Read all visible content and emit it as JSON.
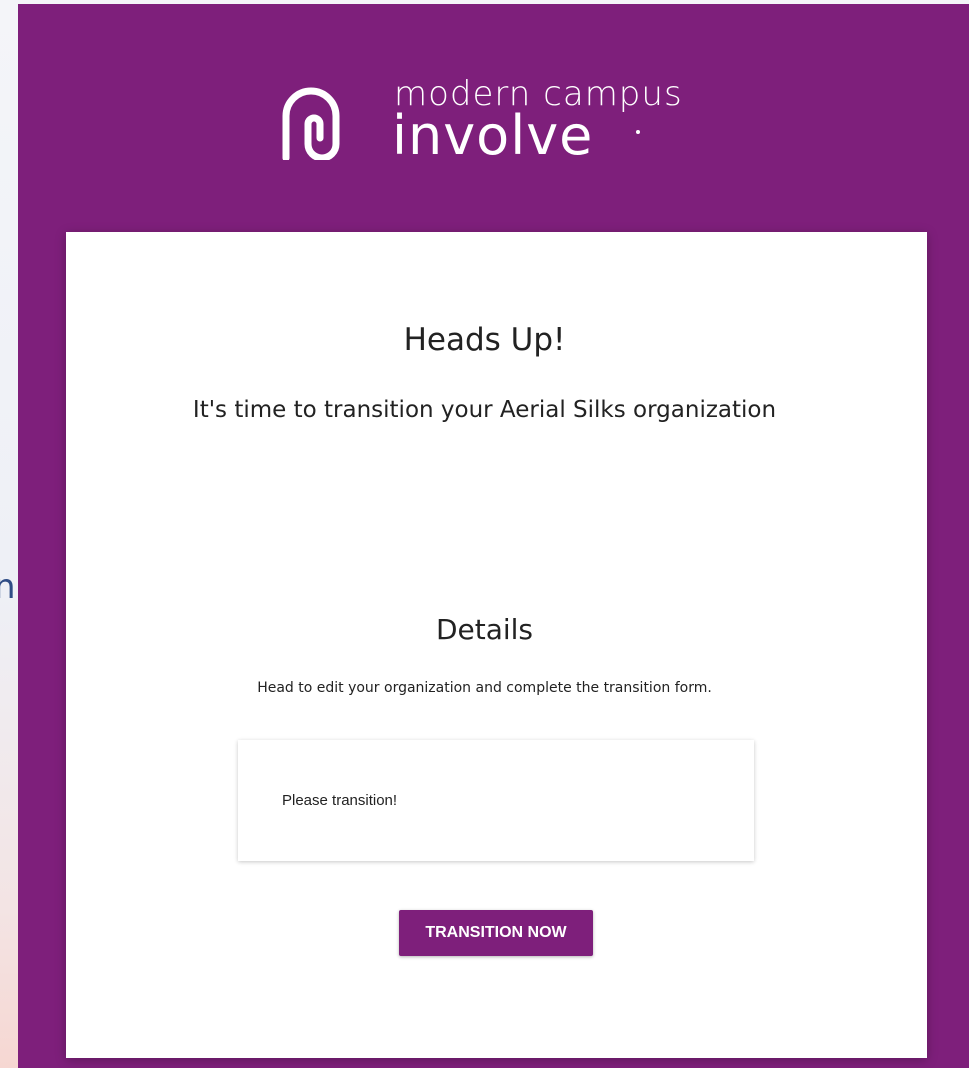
{
  "background": {
    "partial_text": "n"
  },
  "brand": {
    "line1": "modern campus",
    "line2": "involve",
    "logo_icon": "modern-campus-logo-icon",
    "frame_color": "#7e1f7b"
  },
  "notice": {
    "title": "Heads Up!",
    "subtitle": "It's time to transition your Aerial Silks organization"
  },
  "details": {
    "title": "Details",
    "body": "Head to edit your organization and complete the transition form.",
    "message": "Please transition!"
  },
  "actions": {
    "transition_label": "TRANSITION NOW",
    "button_color": "#7e1f7b"
  }
}
